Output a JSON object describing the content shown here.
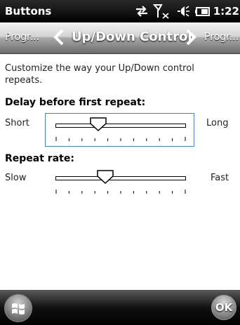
{
  "status": {
    "title": "Buttons",
    "time": "1:22",
    "icons": [
      "connectivity-icon",
      "signal-icon",
      "volume-icon",
      "battery-icon"
    ]
  },
  "tabs": {
    "prev_label": "Progr...",
    "current_label": "Up/Down Control",
    "next_label": "Progr..."
  },
  "content": {
    "intro": "Customize the way your Up/Down control repeats.",
    "delay": {
      "label": "Delay before first repeat:",
      "min_label": "Short",
      "max_label": "Long",
      "value": 0.33,
      "ticks": 11
    },
    "rate": {
      "label": "Repeat rate:",
      "min_label": "Slow",
      "max_label": "Fast",
      "value": 0.38,
      "ticks": 11
    }
  },
  "bottom": {
    "ok_label": "OK"
  },
  "colors": {
    "accent": "#4a7fc4",
    "bar": "#000000"
  }
}
